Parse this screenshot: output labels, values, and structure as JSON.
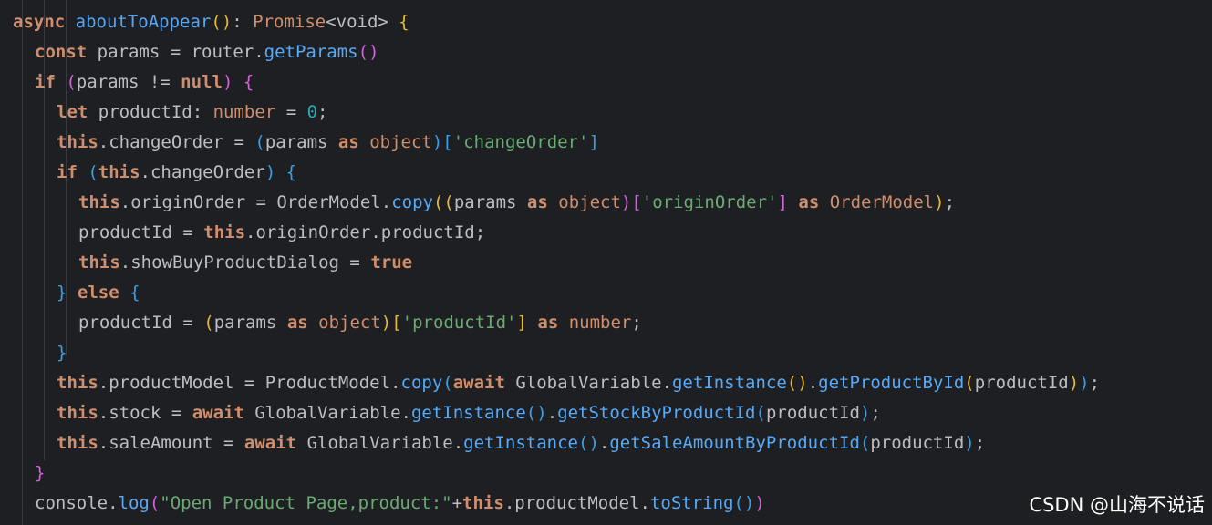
{
  "editor": {
    "watermark": "CSDN @山海不说话",
    "lines": [
      {
        "indent": 0,
        "tokens": [
          {
            "t": "async ",
            "c": "kw"
          },
          {
            "t": "aboutToAppear",
            "c": "fn"
          },
          {
            "t": "()",
            "c": "p1"
          },
          {
            "t": ": ",
            "c": "pl"
          },
          {
            "t": "Promise",
            "c": "ty"
          },
          {
            "t": "<void> ",
            "c": "pl"
          },
          {
            "t": "{",
            "c": "p1"
          }
        ]
      },
      {
        "indent": 1,
        "tokens": [
          {
            "t": "const ",
            "c": "kw"
          },
          {
            "t": "params = router.",
            "c": "pl"
          },
          {
            "t": "getParams",
            "c": "mt"
          },
          {
            "t": "()",
            "c": "p2"
          }
        ]
      },
      {
        "indent": 1,
        "tokens": [
          {
            "t": "if ",
            "c": "kw"
          },
          {
            "t": "(",
            "c": "p2"
          },
          {
            "t": "params != ",
            "c": "pl"
          },
          {
            "t": "null",
            "c": "kw"
          },
          {
            "t": ") ",
            "c": "p2"
          },
          {
            "t": "{",
            "c": "p2"
          }
        ]
      },
      {
        "indent": 2,
        "tokens": [
          {
            "t": "let ",
            "c": "kw"
          },
          {
            "t": "productId: ",
            "c": "pl"
          },
          {
            "t": "number",
            "c": "ty"
          },
          {
            "t": " = ",
            "c": "pl"
          },
          {
            "t": "0",
            "c": "nm"
          },
          {
            "t": ";",
            "c": "pl"
          }
        ]
      },
      {
        "indent": 2,
        "tokens": [
          {
            "t": "this",
            "c": "kw"
          },
          {
            "t": ".changeOrder = ",
            "c": "pl"
          },
          {
            "t": "(",
            "c": "p3"
          },
          {
            "t": "params ",
            "c": "pl"
          },
          {
            "t": "as ",
            "c": "kw"
          },
          {
            "t": "object",
            "c": "ty"
          },
          {
            "t": ")[",
            "c": "p3"
          },
          {
            "t": "'changeOrder'",
            "c": "st"
          },
          {
            "t": "]",
            "c": "p3"
          }
        ]
      },
      {
        "indent": 2,
        "tokens": [
          {
            "t": "if ",
            "c": "kw"
          },
          {
            "t": "(",
            "c": "p3"
          },
          {
            "t": "this",
            "c": "kw"
          },
          {
            "t": ".changeOrder",
            "c": "pl"
          },
          {
            "t": ") ",
            "c": "p3"
          },
          {
            "t": "{",
            "c": "p3"
          }
        ]
      },
      {
        "indent": 3,
        "tokens": [
          {
            "t": "this",
            "c": "kw"
          },
          {
            "t": ".originOrder = OrderModel.",
            "c": "pl"
          },
          {
            "t": "copy",
            "c": "mt"
          },
          {
            "t": "((",
            "c": "p1"
          },
          {
            "t": "params ",
            "c": "pl"
          },
          {
            "t": "as ",
            "c": "kw"
          },
          {
            "t": "object",
            "c": "ty"
          },
          {
            "t": ")[",
            "c": "p2"
          },
          {
            "t": "'originOrder'",
            "c": "st"
          },
          {
            "t": "] ",
            "c": "p2"
          },
          {
            "t": "as ",
            "c": "kw"
          },
          {
            "t": "OrderModel",
            "c": "ty"
          },
          {
            "t": ")",
            "c": "p1"
          },
          {
            "t": ";",
            "c": "pl"
          }
        ]
      },
      {
        "indent": 3,
        "tokens": [
          {
            "t": "productId = ",
            "c": "pl"
          },
          {
            "t": "this",
            "c": "kw"
          },
          {
            "t": ".originOrder.productId;",
            "c": "pl"
          }
        ]
      },
      {
        "indent": 3,
        "tokens": [
          {
            "t": "this",
            "c": "kw"
          },
          {
            "t": ".showBuyProductDialog = ",
            "c": "pl"
          },
          {
            "t": "true",
            "c": "kw"
          }
        ]
      },
      {
        "indent": 2,
        "tokens": [
          {
            "t": "} ",
            "c": "p3"
          },
          {
            "t": "else ",
            "c": "kw"
          },
          {
            "t": "{",
            "c": "p3"
          }
        ]
      },
      {
        "indent": 3,
        "tokens": [
          {
            "t": "productId = ",
            "c": "pl"
          },
          {
            "t": "(",
            "c": "p1"
          },
          {
            "t": "params ",
            "c": "pl"
          },
          {
            "t": "as ",
            "c": "kw"
          },
          {
            "t": "object",
            "c": "ty"
          },
          {
            "t": ")[",
            "c": "p1"
          },
          {
            "t": "'productId'",
            "c": "st"
          },
          {
            "t": "] ",
            "c": "p1"
          },
          {
            "t": "as ",
            "c": "kw"
          },
          {
            "t": "number",
            "c": "ty"
          },
          {
            "t": ";",
            "c": "pl"
          }
        ]
      },
      {
        "indent": 2,
        "tokens": [
          {
            "t": "}",
            "c": "p3"
          }
        ]
      },
      {
        "indent": 2,
        "tokens": [
          {
            "t": "this",
            "c": "kw"
          },
          {
            "t": ".productModel = ProductModel.",
            "c": "pl"
          },
          {
            "t": "copy",
            "c": "mt"
          },
          {
            "t": "(",
            "c": "p3"
          },
          {
            "t": "await ",
            "c": "kw"
          },
          {
            "t": "GlobalVariable.",
            "c": "pl"
          },
          {
            "t": "getInstance",
            "c": "mt"
          },
          {
            "t": "()",
            "c": "p1"
          },
          {
            "t": ".",
            "c": "pl"
          },
          {
            "t": "getProductById",
            "c": "mt"
          },
          {
            "t": "(",
            "c": "p1"
          },
          {
            "t": "productId",
            "c": "pl"
          },
          {
            "t": ")",
            "c": "p1"
          },
          {
            "t": ")",
            "c": "p3"
          },
          {
            "t": ";",
            "c": "pl"
          }
        ]
      },
      {
        "indent": 2,
        "tokens": [
          {
            "t": "this",
            "c": "kw"
          },
          {
            "t": ".stock = ",
            "c": "pl"
          },
          {
            "t": "await ",
            "c": "kw"
          },
          {
            "t": "GlobalVariable.",
            "c": "pl"
          },
          {
            "t": "getInstance",
            "c": "mt"
          },
          {
            "t": "()",
            "c": "p3"
          },
          {
            "t": ".",
            "c": "pl"
          },
          {
            "t": "getStockByProductId",
            "c": "mt"
          },
          {
            "t": "(",
            "c": "p3"
          },
          {
            "t": "productId",
            "c": "pl"
          },
          {
            "t": ")",
            "c": "p3"
          },
          {
            "t": ";",
            "c": "pl"
          }
        ]
      },
      {
        "indent": 2,
        "tokens": [
          {
            "t": "this",
            "c": "kw"
          },
          {
            "t": ".saleAmount = ",
            "c": "pl"
          },
          {
            "t": "await ",
            "c": "kw"
          },
          {
            "t": "GlobalVariable.",
            "c": "pl"
          },
          {
            "t": "getInstance",
            "c": "mt"
          },
          {
            "t": "()",
            "c": "p3"
          },
          {
            "t": ".",
            "c": "pl"
          },
          {
            "t": "getSaleAmountByProductId",
            "c": "mt"
          },
          {
            "t": "(",
            "c": "p3"
          },
          {
            "t": "productId",
            "c": "pl"
          },
          {
            "t": ")",
            "c": "p3"
          },
          {
            "t": ";",
            "c": "pl"
          }
        ]
      },
      {
        "indent": 1,
        "tokens": [
          {
            "t": "}",
            "c": "p2"
          }
        ]
      },
      {
        "indent": 1,
        "tokens": [
          {
            "t": "console.",
            "c": "pl"
          },
          {
            "t": "log",
            "c": "mt"
          },
          {
            "t": "(",
            "c": "p2"
          },
          {
            "t": "\"Open Product Page,product:\"",
            "c": "st"
          },
          {
            "t": "+",
            "c": "pl"
          },
          {
            "t": "this",
            "c": "kw"
          },
          {
            "t": ".productModel.",
            "c": "pl"
          },
          {
            "t": "toString",
            "c": "mt"
          },
          {
            "t": "()",
            "c": "p3"
          },
          {
            "t": ")",
            "c": "p2"
          }
        ]
      }
    ]
  }
}
